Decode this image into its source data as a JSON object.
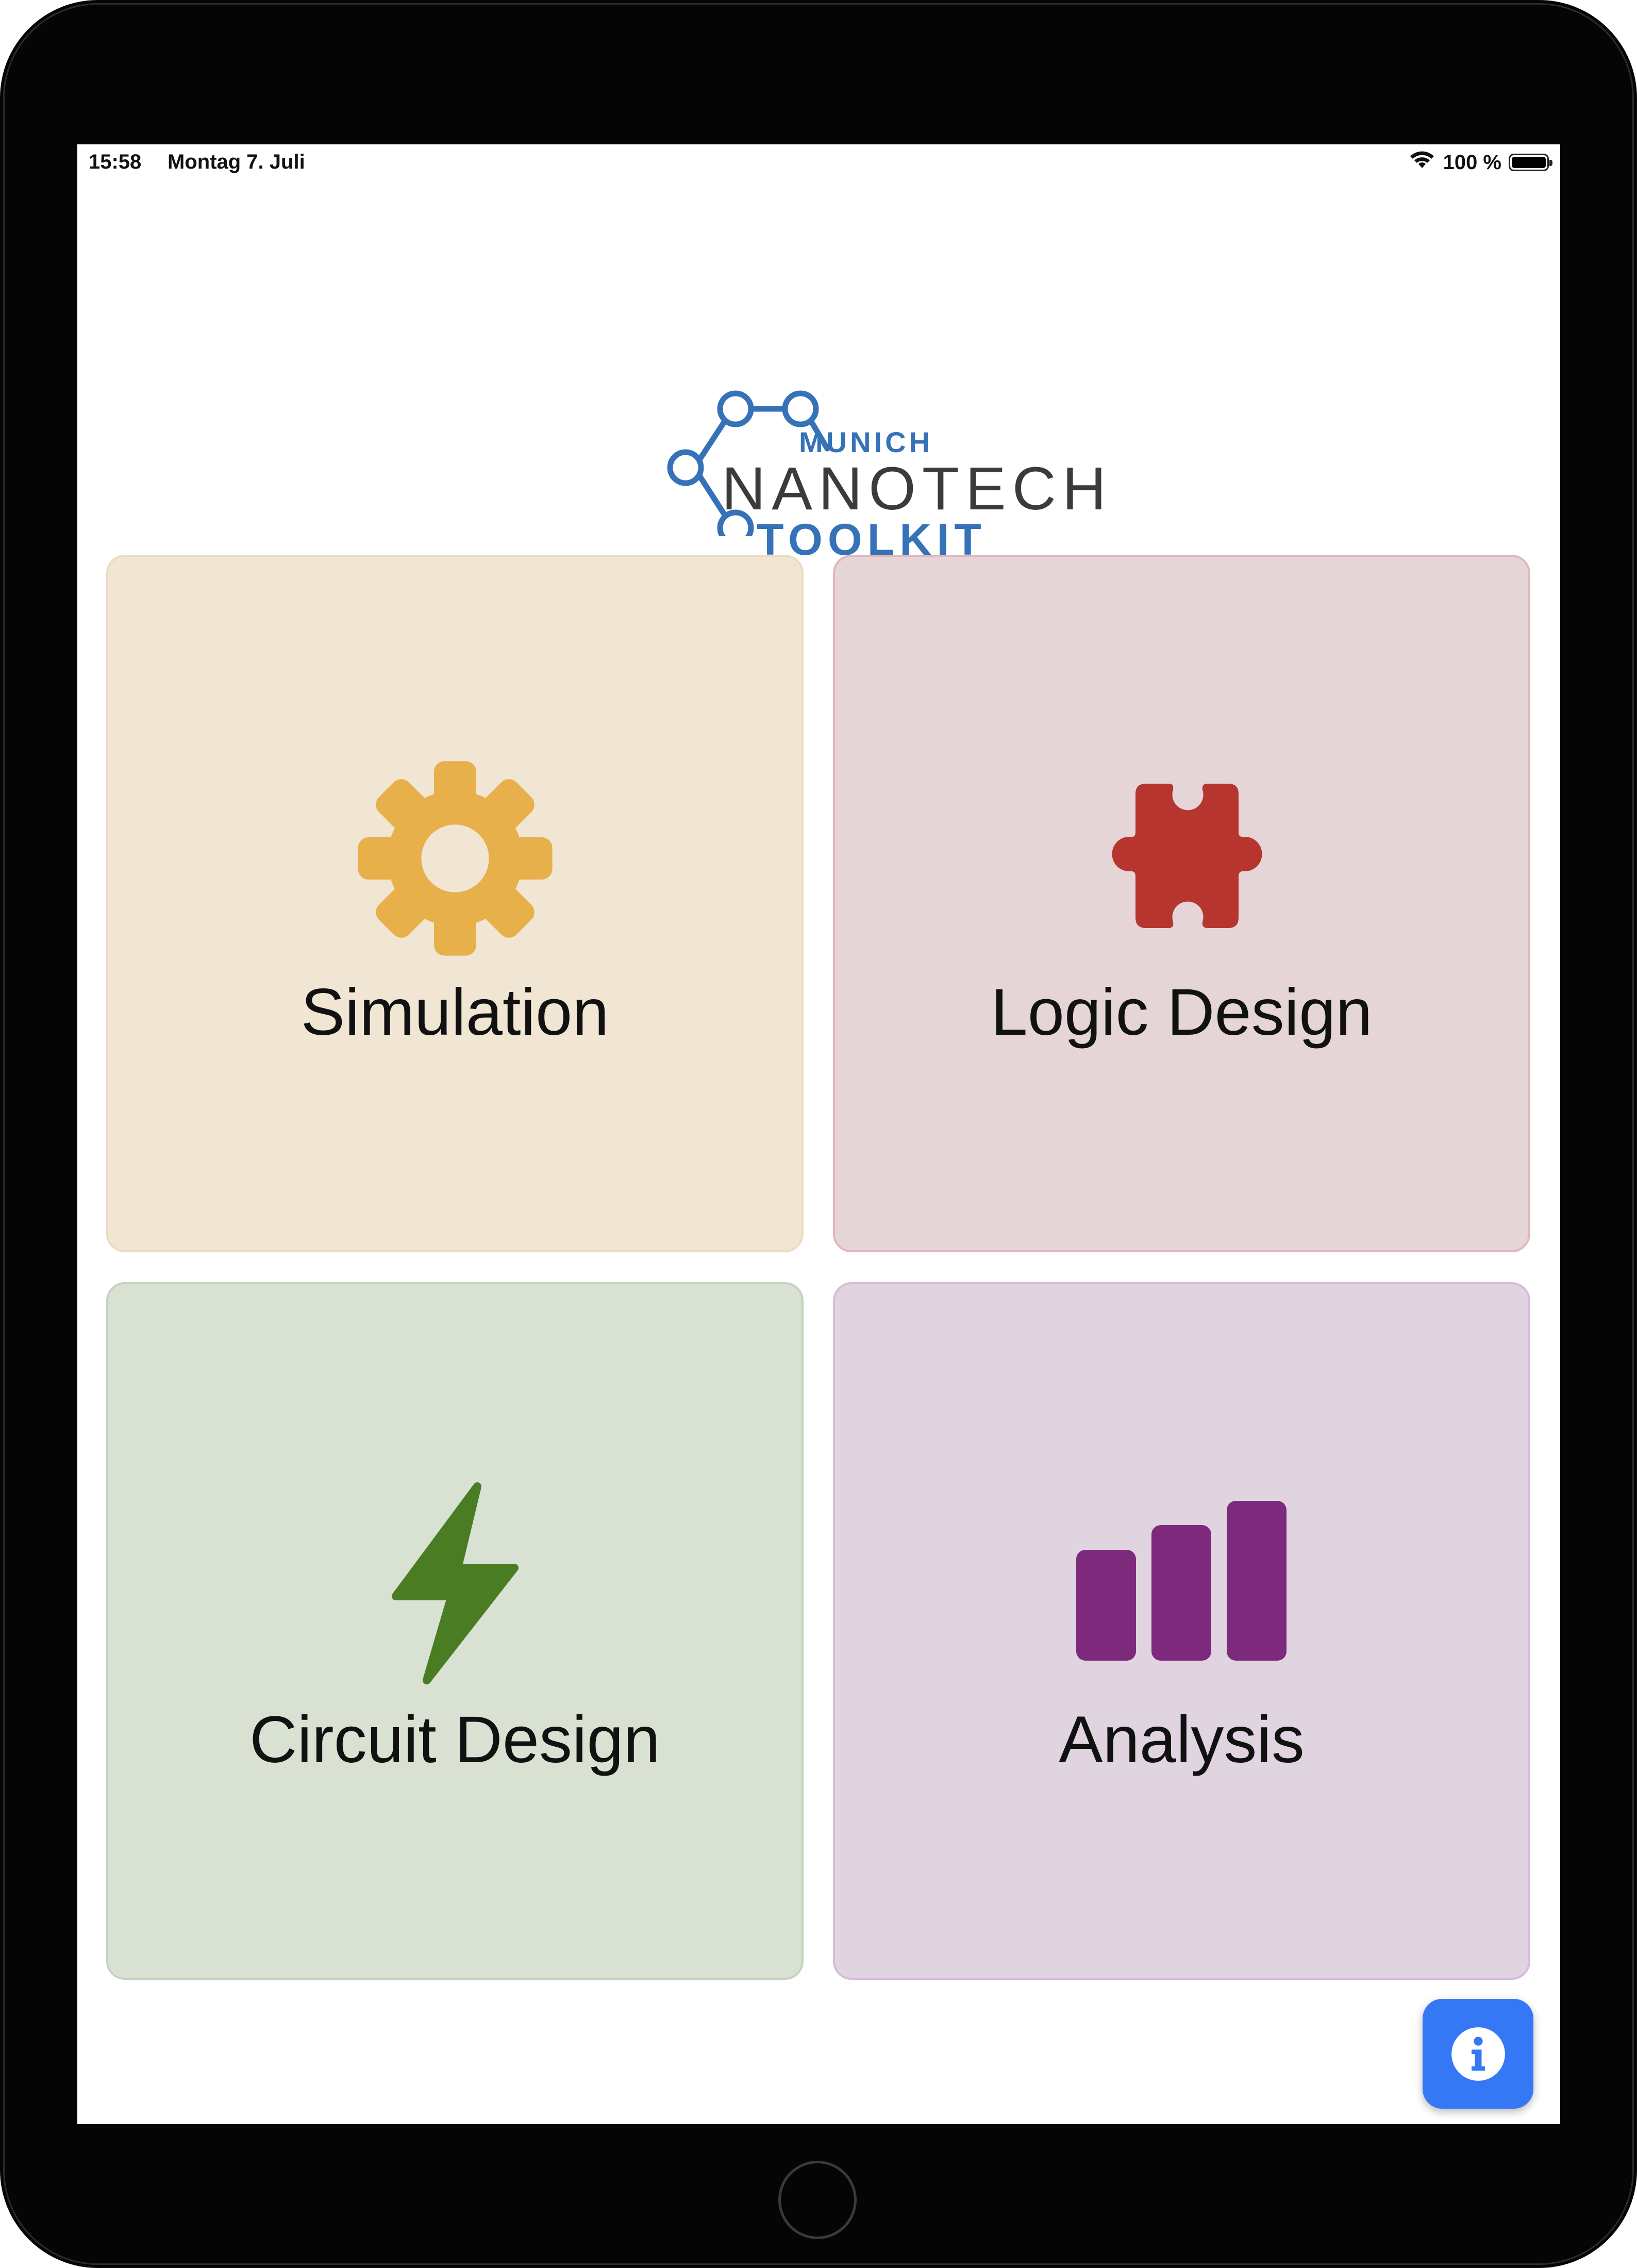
{
  "status_bar": {
    "time": "15:58",
    "date": "Montag 7. Juli",
    "battery_percent": "100 %",
    "battery_level": 1.0,
    "wifi_icon": "wifi-icon",
    "battery_icon": "battery-icon"
  },
  "logo": {
    "line1": "MUNICH",
    "line2": "NANOTECH",
    "line3": "TOOLKIT",
    "brand_blue": "#3572b8",
    "brand_dark": "#3b3b3b"
  },
  "tiles": [
    {
      "label": "Simulation",
      "icon": "gear-icon",
      "color": "#e8b04a",
      "background": "#f1e6d4"
    },
    {
      "label": "Logic Design",
      "icon": "puzzle-piece-icon",
      "color": "#b6352f",
      "background": "#e6d5d6"
    },
    {
      "label": "Circuit Design",
      "icon": "lightning-bolt-icon",
      "color": "#4a7c24",
      "background": "#d9e1d3"
    },
    {
      "label": "Analysis",
      "icon": "bar-chart-icon",
      "color": "#7d2a7d",
      "background": "#e0d4e1"
    }
  ],
  "info_button": {
    "icon": "info-icon",
    "color": "#3478f6"
  }
}
